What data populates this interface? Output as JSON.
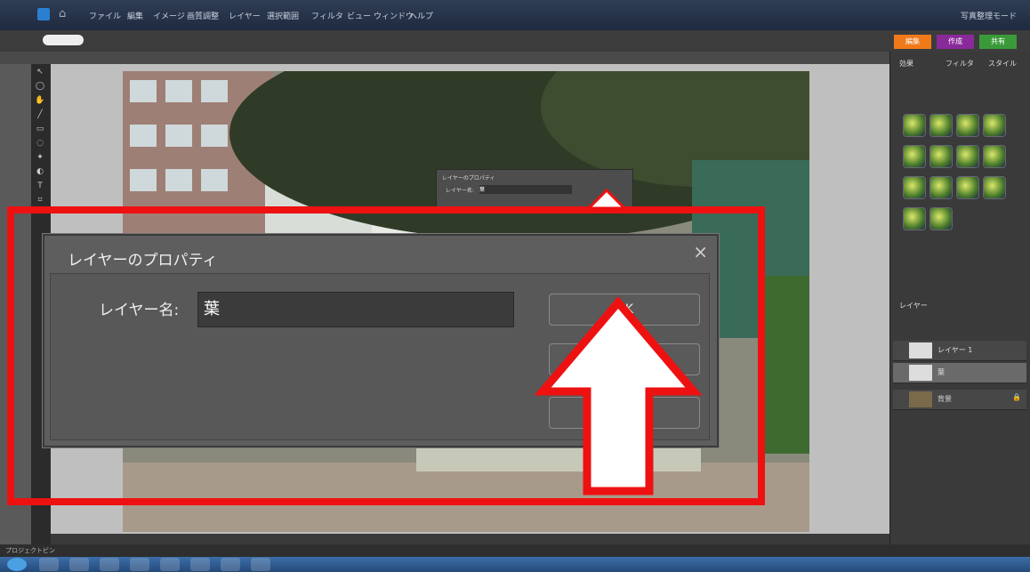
{
  "colors": {
    "highlight": "#ee1111",
    "accent_orange": "#f07a1a",
    "accent_purple": "#8a2a9a",
    "accent_green": "#3a9a3a"
  },
  "menubar": {
    "items": [
      "ファイル",
      "編集",
      "イメージ",
      "画質調整",
      "レイヤー",
      "選択範囲",
      "フィルタ",
      "ビュー",
      "ウィンドウ",
      "ヘルプ"
    ],
    "right_label": "写真整理モード"
  },
  "mode_tabs": [
    "編集",
    "作成",
    "共有"
  ],
  "panel": {
    "effects_tabs": [
      "効果",
      "フィルタ",
      "スタイル"
    ],
    "layers_header": "レイヤー",
    "layers": [
      {
        "name": "レイヤー 1",
        "icon": "eye-icon"
      },
      {
        "name": "葉",
        "icon": "eye-icon"
      },
      {
        "name": "背景",
        "icon": "lock-icon"
      }
    ],
    "bin_label": "プロジェクトビン"
  },
  "small_dialog": {
    "title": "レイヤーのプロパティ",
    "label": "レイヤー名:",
    "value": "葉"
  },
  "dialog": {
    "title": "レイヤーのプロパティ",
    "close_label": "×",
    "name_label": "レイヤー名:",
    "name_value": "葉",
    "ok_label": "OK"
  }
}
